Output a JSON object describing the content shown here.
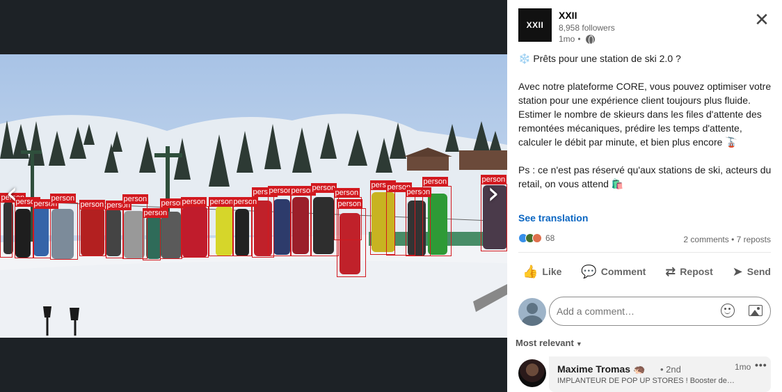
{
  "viewer": {
    "prev_icon": "chevron-left-icon",
    "next_icon": "chevron-right-icon",
    "prev_glyph": "‹",
    "next_glyph": "›",
    "detection_label": "person",
    "detection_color": "#d2191f"
  },
  "post": {
    "company": {
      "logo_text": "XXII",
      "name": "XXII",
      "followers": "8,958 followers",
      "time": "1mo",
      "separator": "•",
      "visibility_icon": "globe-icon"
    },
    "close_glyph": "✕",
    "text": {
      "line1": "❄️ Prêts pour une station de ski 2.0 ?",
      "paragraph2": "Avec notre plateforme CORE, vous pouvez optimiser votre station pour une expérience client toujours plus fluide. Estimer le nombre de skieurs dans les files d'attente des remontées mécaniques, prédire les temps d'attente, calculer le débit par minute, et bien plus encore 🚡",
      "paragraph3": "Ps : ce n'est pas réservé qu'aux stations de ski, acteurs du retail, on vous attend 🛍️"
    },
    "see_translation": "See translation",
    "reactions_count": "68",
    "social_counts": "2 comments • 7 reposts",
    "actions": [
      {
        "label": "Like",
        "icon": "thumbs-up-icon",
        "glyph": "👍"
      },
      {
        "label": "Comment",
        "icon": "comment-icon",
        "glyph": "💬"
      },
      {
        "label": "Repost",
        "icon": "repost-icon",
        "glyph": "⇄"
      },
      {
        "label": "Send",
        "icon": "send-icon",
        "glyph": "➤"
      }
    ]
  },
  "comment_box": {
    "placeholder": "Add a comment…"
  },
  "sort": {
    "label": "Most relevant",
    "chevron": "▼"
  },
  "comments": [
    {
      "name": "Maxime Tromas 🦔",
      "degree": "• 2nd",
      "headline": "IMPLANTEUR DE POP UP STORES ! Booster de…",
      "time": "1mo",
      "more": "•••"
    }
  ],
  "colors": {
    "accent": "#0a66c2",
    "viewer_bg": "#1d2226",
    "box": "#d2191f"
  }
}
